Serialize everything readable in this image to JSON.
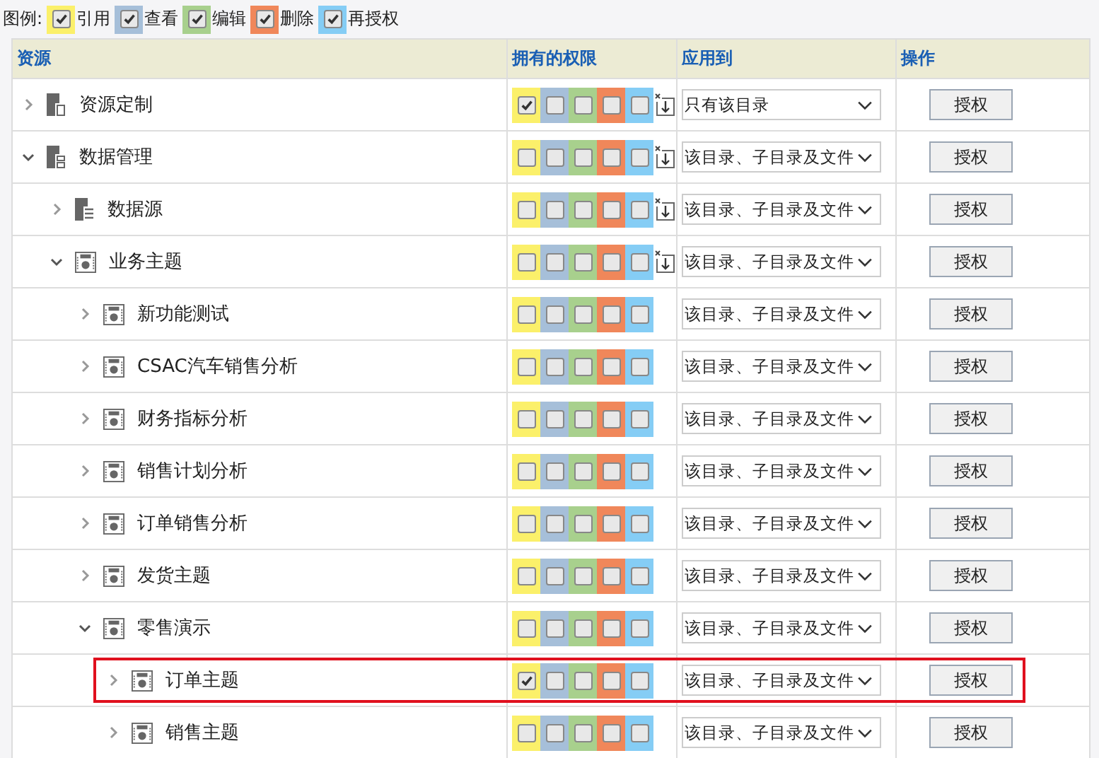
{
  "legend": {
    "title": "图例:",
    "items": [
      {
        "label": "引用",
        "color": "#fbf06a",
        "checked": true
      },
      {
        "label": "查看",
        "color": "#a6bfd9",
        "checked": true
      },
      {
        "label": "编辑",
        "color": "#a8d08d",
        "checked": true
      },
      {
        "label": "删除",
        "color": "#f0875a",
        "checked": true
      },
      {
        "label": "再授权",
        "color": "#85cdf5",
        "checked": true
      }
    ]
  },
  "table": {
    "columns": [
      "资源",
      "拥有的权限",
      "应用到",
      "操作"
    ],
    "rows": [
      {
        "label": "资源定制",
        "kind": "custom",
        "expanded": false,
        "highlighted": false,
        "sync_icon": true,
        "permissions": [
          {
            "checked": true
          },
          {
            "checked": false
          },
          {
            "checked": false
          },
          {
            "checked": false
          },
          {
            "checked": false
          }
        ],
        "apply_to": "只有该目录",
        "action": "授权"
      },
      {
        "label": "数据管理",
        "kind": "data",
        "expanded": true,
        "highlighted": false,
        "sync_icon": true,
        "permissions": [
          {
            "checked": false
          },
          {
            "checked": false
          },
          {
            "checked": false
          },
          {
            "checked": false
          },
          {
            "checked": false
          }
        ],
        "apply_to": "该目录、子目录及文件",
        "action": "授权",
        "children": [
          {
            "label": "数据源",
            "kind": "source",
            "expanded": false,
            "highlighted": false,
            "sync_icon": true,
            "permissions": [
              {
                "checked": false
              },
              {
                "checked": false
              },
              {
                "checked": false
              },
              {
                "checked": false
              },
              {
                "checked": false
              }
            ],
            "apply_to": "该目录、子目录及文件",
            "action": "授权"
          },
          {
            "label": "业务主题",
            "kind": "theme",
            "expanded": true,
            "highlighted": false,
            "sync_icon": true,
            "permissions": [
              {
                "checked": false
              },
              {
                "checked": false
              },
              {
                "checked": false
              },
              {
                "checked": false
              },
              {
                "checked": false
              }
            ],
            "apply_to": "该目录、子目录及文件",
            "action": "授权",
            "children": [
              {
                "label": "新功能测试",
                "kind": "theme",
                "expanded": false,
                "highlighted": false,
                "sync_icon": false,
                "permissions": [
                  {
                    "checked": false
                  },
                  {
                    "checked": false
                  },
                  {
                    "checked": false
                  },
                  {
                    "checked": false
                  },
                  {
                    "checked": false
                  }
                ],
                "apply_to": "该目录、子目录及文件",
                "action": "授权"
              },
              {
                "label": "CSAC汽车销售分析",
                "kind": "theme",
                "expanded": false,
                "highlighted": false,
                "sync_icon": false,
                "permissions": [
                  {
                    "checked": false
                  },
                  {
                    "checked": false
                  },
                  {
                    "checked": false
                  },
                  {
                    "checked": false
                  },
                  {
                    "checked": false
                  }
                ],
                "apply_to": "该目录、子目录及文件",
                "action": "授权"
              },
              {
                "label": "财务指标分析",
                "kind": "theme",
                "expanded": false,
                "highlighted": false,
                "sync_icon": false,
                "permissions": [
                  {
                    "checked": false
                  },
                  {
                    "checked": false
                  },
                  {
                    "checked": false
                  },
                  {
                    "checked": false
                  },
                  {
                    "checked": false
                  }
                ],
                "apply_to": "该目录、子目录及文件",
                "action": "授权"
              },
              {
                "label": "销售计划分析",
                "kind": "theme",
                "expanded": false,
                "highlighted": false,
                "sync_icon": false,
                "permissions": [
                  {
                    "checked": false
                  },
                  {
                    "checked": false
                  },
                  {
                    "checked": false
                  },
                  {
                    "checked": false
                  },
                  {
                    "checked": false
                  }
                ],
                "apply_to": "该目录、子目录及文件",
                "action": "授权"
              },
              {
                "label": "订单销售分析",
                "kind": "theme",
                "expanded": false,
                "highlighted": false,
                "sync_icon": false,
                "permissions": [
                  {
                    "checked": false
                  },
                  {
                    "checked": false
                  },
                  {
                    "checked": false
                  },
                  {
                    "checked": false
                  },
                  {
                    "checked": false
                  }
                ],
                "apply_to": "该目录、子目录及文件",
                "action": "授权"
              },
              {
                "label": "发货主题",
                "kind": "theme",
                "expanded": false,
                "highlighted": false,
                "sync_icon": false,
                "permissions": [
                  {
                    "checked": false
                  },
                  {
                    "checked": false
                  },
                  {
                    "checked": false
                  },
                  {
                    "checked": false
                  },
                  {
                    "checked": false
                  }
                ],
                "apply_to": "该目录、子目录及文件",
                "action": "授权"
              },
              {
                "label": "零售演示",
                "kind": "theme",
                "expanded": true,
                "highlighted": false,
                "sync_icon": false,
                "permissions": [
                  {
                    "checked": false
                  },
                  {
                    "checked": false
                  },
                  {
                    "checked": false
                  },
                  {
                    "checked": false
                  },
                  {
                    "checked": false
                  }
                ],
                "apply_to": "该目录、子目录及文件",
                "action": "授权",
                "children": [
                  {
                    "label": "订单主题",
                    "kind": "theme",
                    "expanded": false,
                    "highlighted": true,
                    "sync_icon": false,
                    "permissions": [
                      {
                        "checked": true
                      },
                      {
                        "checked": false
                      },
                      {
                        "checked": false
                      },
                      {
                        "checked": false
                      },
                      {
                        "checked": false
                      }
                    ],
                    "apply_to": "该目录、子目录及文件",
                    "action": "授权"
                  },
                  {
                    "label": "销售主题",
                    "kind": "theme",
                    "expanded": false,
                    "highlighted": false,
                    "sync_icon": false,
                    "permissions": [
                      {
                        "checked": false
                      },
                      {
                        "checked": false
                      },
                      {
                        "checked": false
                      },
                      {
                        "checked": false
                      },
                      {
                        "checked": false
                      }
                    ],
                    "apply_to": "该目录、子目录及文件",
                    "action": "授权"
                  }
                ]
              }
            ]
          }
        ]
      }
    ]
  }
}
